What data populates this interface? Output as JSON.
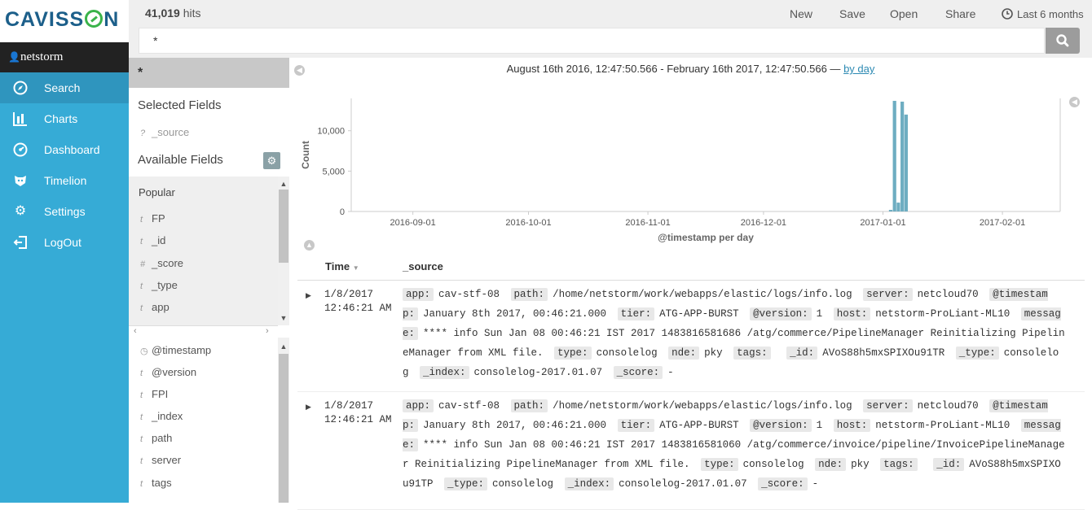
{
  "brand": {
    "logo_pre": "CAVISS",
    "logo_post": "N",
    "user": "netstorm"
  },
  "nav": [
    {
      "label": "Search",
      "icon": "compass-icon"
    },
    {
      "label": "Charts",
      "icon": "bar-chart-icon"
    },
    {
      "label": "Dashboard",
      "icon": "dashboard-icon"
    },
    {
      "label": "Timelion",
      "icon": "timelion-icon"
    },
    {
      "label": "Settings",
      "icon": "gear-icon"
    },
    {
      "label": "LogOut",
      "icon": "logout-icon"
    }
  ],
  "toolbar": {
    "hits_count": "41,019",
    "hits_label": "hits",
    "new": "New",
    "save": "Save",
    "open": "Open",
    "share": "Share",
    "timepicker": "Last 6 months"
  },
  "search": {
    "query": "*"
  },
  "sidebar": {
    "index_pattern": "*",
    "selected_title": "Selected Fields",
    "selected_field": "_source",
    "available_title": "Available Fields",
    "popular_title": "Popular",
    "popular": [
      {
        "type": "t",
        "name": "FP"
      },
      {
        "type": "t",
        "name": "_id"
      },
      {
        "type": "#",
        "name": "_score"
      },
      {
        "type": "t",
        "name": "_type"
      },
      {
        "type": "t",
        "name": "app"
      }
    ],
    "fields": [
      {
        "type": "clock",
        "name": "@timestamp"
      },
      {
        "type": "t",
        "name": "@version"
      },
      {
        "type": "t",
        "name": "FPI"
      },
      {
        "type": "t",
        "name": "_index"
      },
      {
        "type": "t",
        "name": "path"
      },
      {
        "type": "t",
        "name": "server"
      },
      {
        "type": "t",
        "name": "tags"
      }
    ]
  },
  "range": {
    "text": "August 16th 2016, 12:47:50.566 - February 16th 2017, 12:47:50.566 —",
    "interval": "by day"
  },
  "chart_data": {
    "type": "bar",
    "ylabel": "Count",
    "xlabel": "@timestamp per day",
    "ylim": [
      0,
      14000
    ],
    "yticks": [
      {
        "value": 0,
        "label": "0"
      },
      {
        "value": 5000,
        "label": "5,000"
      },
      {
        "value": 10000,
        "label": "10,000"
      }
    ],
    "xticks": [
      "2016-09-01",
      "2016-10-01",
      "2016-11-01",
      "2016-12-01",
      "2017-01-01",
      "2017-02-01"
    ],
    "xlim": [
      "2016-08-16",
      "2017-02-16"
    ],
    "bars": [
      {
        "date": "2017-01-03",
        "value": 200
      },
      {
        "date": "2017-01-04",
        "value": 13700
      },
      {
        "date": "2017-01-05",
        "value": 1100
      },
      {
        "date": "2017-01-06",
        "value": 13600
      },
      {
        "date": "2017-01-07",
        "value": 12000
      }
    ],
    "bar_color": "#6eadc1"
  },
  "table": {
    "col_time": "Time",
    "col_source": "_source",
    "rows": [
      {
        "date": "1/8/2017",
        "time": "12:46:21 AM",
        "fields": [
          [
            "app:",
            "cav-stf-08"
          ],
          [
            "path:",
            "/home/netstorm/work/webapps/elastic/logs/info.log"
          ],
          [
            "server:",
            "netcloud70"
          ],
          [
            "@timestamp:",
            "January 8th 2017, 00:46:21.000"
          ],
          [
            "tier:",
            "ATG-APP-BURST"
          ],
          [
            "@version:",
            "1"
          ],
          [
            "host:",
            "netstorm-ProLiant-ML10"
          ],
          [
            "message:",
            "**** info Sun Jan 08 00:46:21 IST 2017 1483816581686 /atg/commerce/PipelineManager Reinitializing PipelineManager from XML file."
          ],
          [
            "type:",
            "consolelog"
          ],
          [
            "nde:",
            "pky"
          ],
          [
            "tags:",
            ""
          ],
          [
            "_id:",
            "AVoS88h5mxSPIXOu91TR"
          ],
          [
            "_type:",
            "consolelog"
          ],
          [
            "_index:",
            "consolelog-2017.01.07"
          ],
          [
            "_score:",
            "-"
          ]
        ]
      },
      {
        "date": "1/8/2017",
        "time": "12:46:21 AM",
        "fields": [
          [
            "app:",
            "cav-stf-08"
          ],
          [
            "path:",
            "/home/netstorm/work/webapps/elastic/logs/info.log"
          ],
          [
            "server:",
            "netcloud70"
          ],
          [
            "@timestamp:",
            "January 8th 2017, 00:46:21.000"
          ],
          [
            "tier:",
            "ATG-APP-BURST"
          ],
          [
            "@version:",
            "1"
          ],
          [
            "host:",
            "netstorm-ProLiant-ML10"
          ],
          [
            "message:",
            "**** info Sun Jan 08 00:46:21 IST 2017 1483816581060 /atg/commerce/invoice/pipeline/InvoicePipelineManager Reinitializing PipelineManager from XML file."
          ],
          [
            "type:",
            "consolelog"
          ],
          [
            "nde:",
            "pky"
          ],
          [
            "tags:",
            ""
          ],
          [
            "_id:",
            "AVoS88h5mxSPIXOu91TP"
          ],
          [
            "_type:",
            "consolelog"
          ],
          [
            "_index:",
            "consolelog-2017.01.07"
          ],
          [
            "_score:",
            "-"
          ]
        ]
      }
    ]
  }
}
